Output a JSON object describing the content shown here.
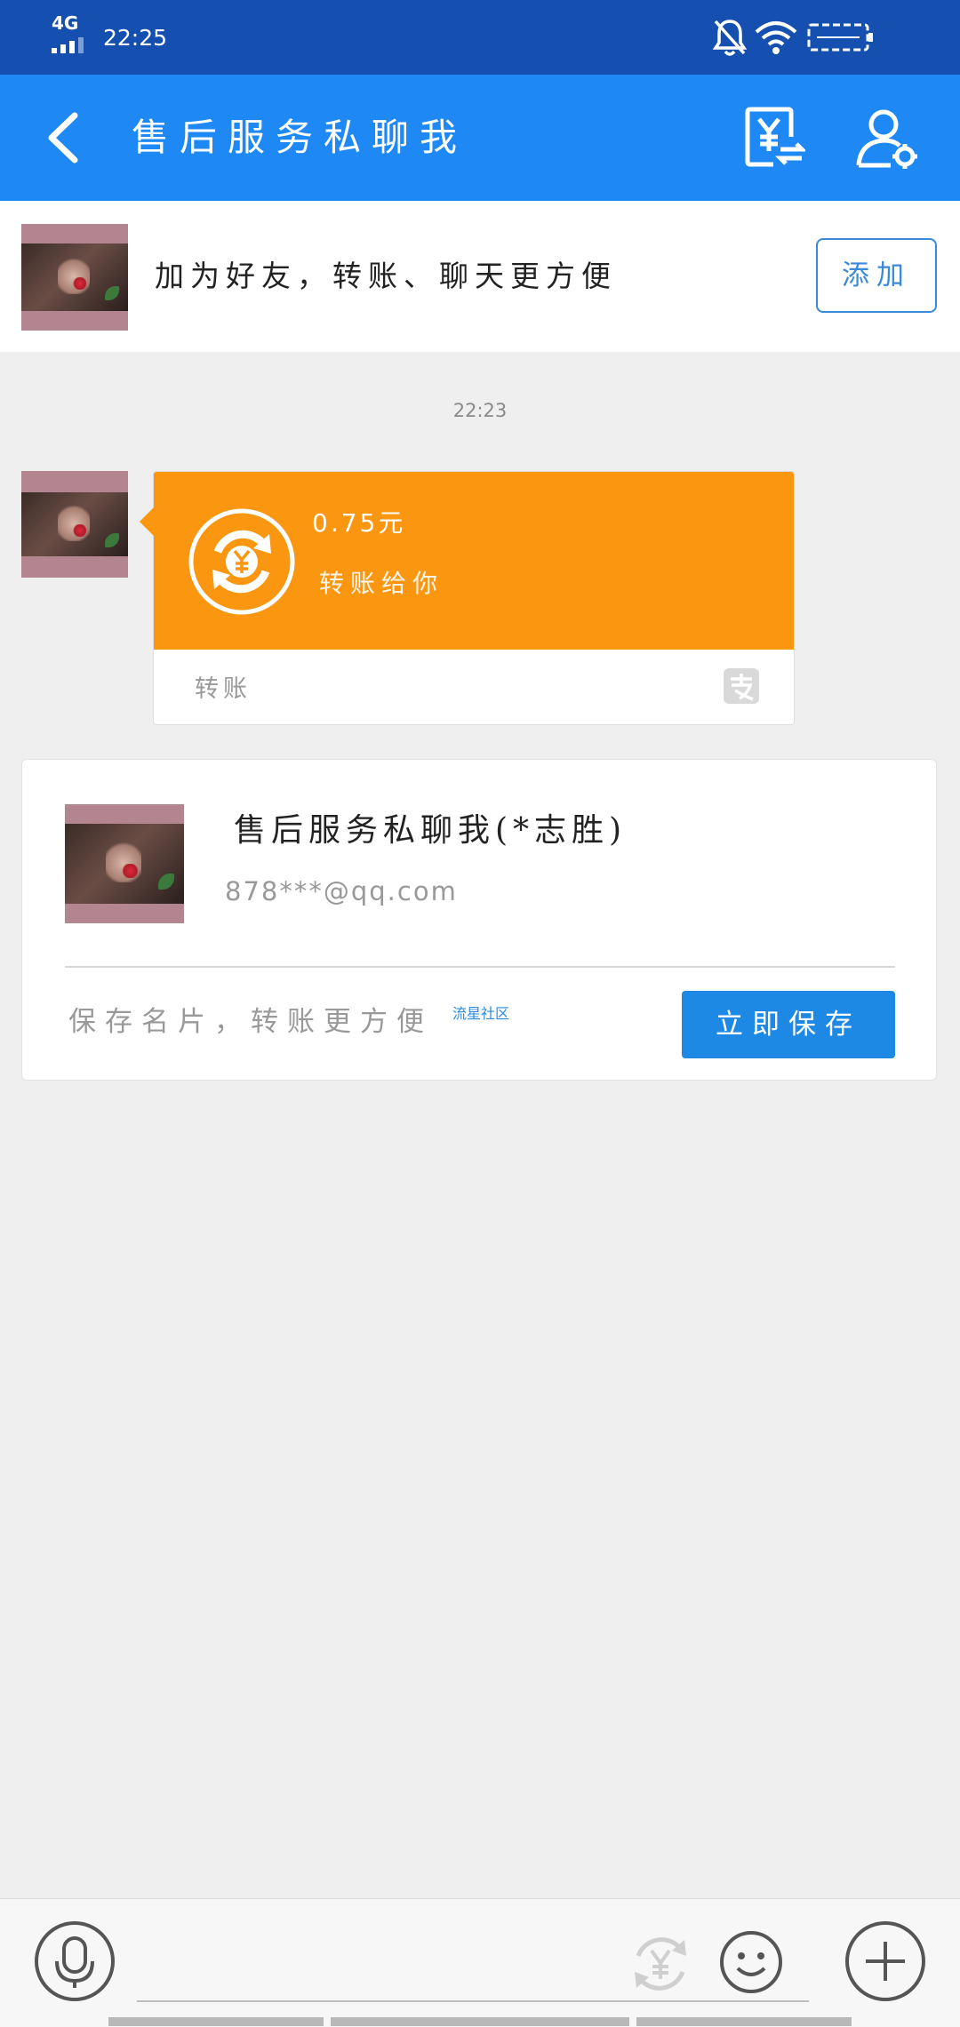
{
  "status_bar": {
    "network": "4G",
    "time": "22:25"
  },
  "header": {
    "title": "售后服务私聊我"
  },
  "friend_banner": {
    "text": "加为好友，转账、聊天更方便",
    "add_label": "添加"
  },
  "chat": {
    "timestamp": "22:23",
    "transfer": {
      "amount": "0.75元",
      "desc": "转账给你",
      "label": "转账"
    }
  },
  "card": {
    "name": "售后服务私聊我(*志胜)",
    "email": "878***@qq.com",
    "hint": "保存名片，转账更方便",
    "tag": "流星社区",
    "save_label": "立即保存"
  },
  "colors": {
    "status_bar": "#1550b0",
    "app_bar": "#1e88f5",
    "transfer_orange": "#fa9610",
    "button_blue": "#1e88e5"
  }
}
